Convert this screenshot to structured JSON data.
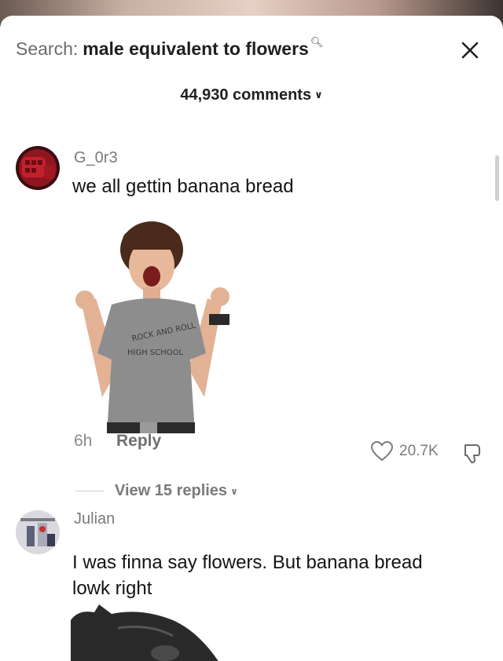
{
  "header": {
    "search_prefix": "Search:",
    "search_query": "male equivalent to flowers",
    "search_icon": "search-icon",
    "close_icon": "close-icon"
  },
  "comments_header": {
    "count_label": "44,930 comments",
    "chevron_icon": "chevron-down-icon"
  },
  "comments": [
    {
      "username": "G_0r3",
      "text": "we all gettin banana bread",
      "time": "6h",
      "reply_label": "Reply",
      "likes": "20.7K",
      "view_replies": "View 15 replies"
    },
    {
      "username": "Julian",
      "text_line1": "I was finna say flowers. But banana bread",
      "text_line2": "lowk right"
    }
  ],
  "colors": {
    "accent_text": "#1f1f1f",
    "muted": "#7a7a7a",
    "sheet": "#ffffff"
  }
}
